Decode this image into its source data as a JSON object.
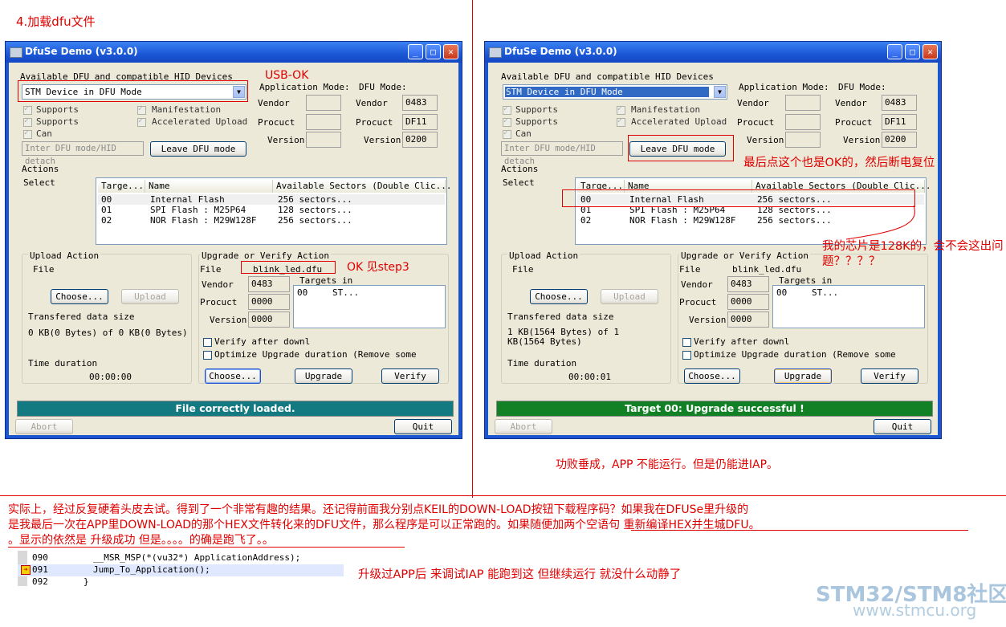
{
  "heading": "4.加载dfu文件",
  "window_title": "DfuSe Demo (v3.0.0)",
  "left": {
    "devices_label": "Available DFU and compatible HID Devices",
    "device_selected": "STM Device in DFU Mode",
    "cb_supports1": "Supports",
    "cb_supports2": "Supports",
    "cb_can": "Can",
    "cb_manifestation": "Manifestation",
    "cb_accel": "Accelerated Upload",
    "enter_dfu": "Inter DFU mode/HID detach",
    "leave_dfu": "Leave DFU mode",
    "app_mode": "Application Mode:",
    "dfu_mode": "DFU Mode:",
    "vendor": "Vendor",
    "procuct": "Procuct",
    "version": "Version",
    "dfu_vendor": "0483",
    "dfu_procuct": "DF11",
    "dfu_version": "0200",
    "actions": "Actions",
    "select": "Select",
    "col_target": "Targe...",
    "col_name": "Name",
    "col_sectors": "Available Sectors (Double Clic...",
    "rows": [
      {
        "id": "00",
        "name": "Internal Flash",
        "sectors": "256 sectors..."
      },
      {
        "id": "01",
        "name": "SPI Flash : M25P64",
        "sectors": "128 sectors..."
      },
      {
        "id": "02",
        "name": "NOR Flash : M29W128F",
        "sectors": "256 sectors..."
      }
    ],
    "upload_action": "Upload Action",
    "file": "File",
    "choose": "Choose...",
    "upload": "Upload",
    "transfered": "Transfered data size",
    "transfered_value": "0 KB(0 Bytes) of 0 KB(0 Bytes)",
    "time_duration": "Time duration",
    "time_value": "00:00:00",
    "upgrade_verify": "Upgrade or Verify Action",
    "file_value": "blink_led.dfu",
    "u_vendor": "0483",
    "u_procuct": "0000",
    "u_version": "0000",
    "targets_in": "Targets in",
    "t_id": "00",
    "t_name": "ST...",
    "verify_after": "Verify after downl",
    "optimize": "Optimize Upgrade duration (Remove some",
    "choose2": "Choose...",
    "upgrade": "Upgrade",
    "verify": "Verify",
    "status": "File correctly loaded.",
    "abort": "Abort",
    "quit": "Quit"
  },
  "right": {
    "transfered_value": "1 KB(1564 Bytes) of 1 KB(1564 Bytes)",
    "time_value": "00:00:01",
    "status": "Target 00: Upgrade successful !"
  },
  "colors": {
    "status_left": "#137a82",
    "status_right": "#128024",
    "annotation": "#e00000"
  },
  "annotations": {
    "usb_ok": "USB-OK",
    "ok_step3": "OK 见step3",
    "last_click": "最后点这个也是OK的，然后断电复位",
    "chip_128k": "我的芯片是128K的，会不会这出问题？？？？",
    "success_note": "功败垂成，APP 不能运行。但是仍能进IAP。",
    "para_line1": "实际上，经过反复硬着头皮去试。得到了一个非常有趣的结果。还记得前面我分别点KEIL的DOWN-LOAD按钮下载程序码？如果我在DFUSe里升级的",
    "para_line2": "是我最后一次在APP里DOWN-LOAD的那个HEX文件转化来的DFU文件，那么程序是可以正常跑的。如果随便加两个空语句 重新编译HEX并生城DFU。",
    "para_line3": "。显示的依然是 升级成功 但是。。。。的确是跑飞了。。",
    "debug_note": "升级过APP后 来调试IAP 能跑到这 但继续运行 就没什么动静了"
  },
  "code": [
    {
      "num": "090",
      "text": "__MSR_MSP(*(vu32*) ApplicationAddress);"
    },
    {
      "num": "091",
      "text": "Jump_To_Application();"
    },
    {
      "num": "092",
      "text": "}"
    }
  ],
  "watermark": {
    "title": "STM32/STM8社区",
    "url": "www.stmcu.org"
  }
}
